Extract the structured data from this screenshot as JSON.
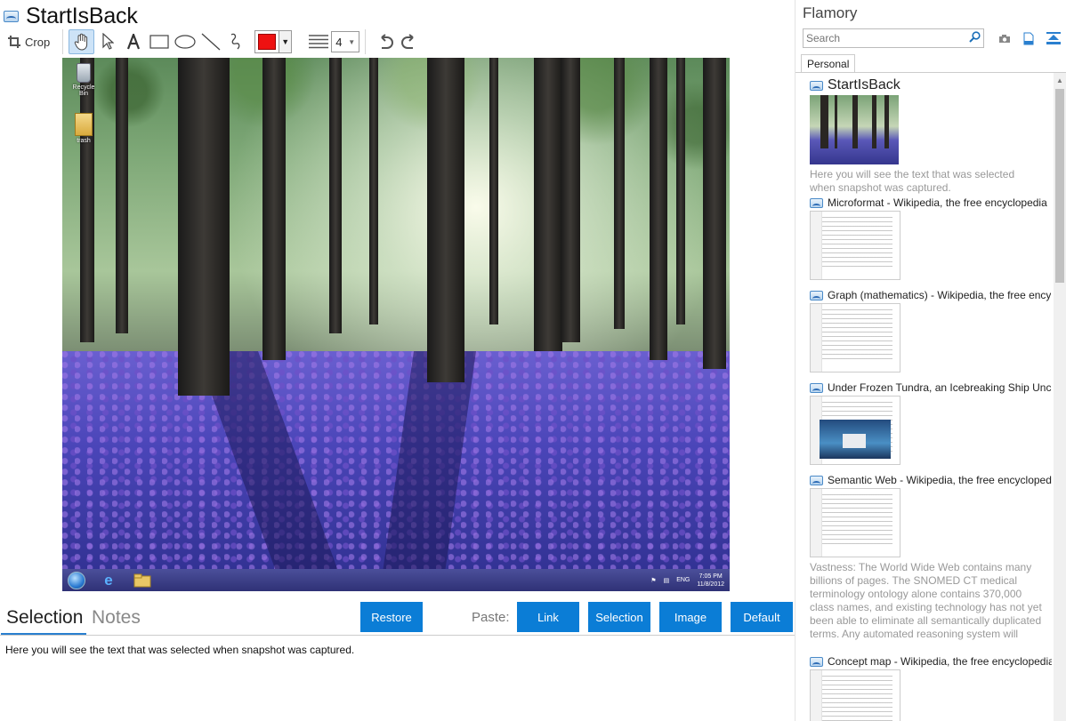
{
  "editor": {
    "title": "StartIsBack",
    "toolbar": {
      "crop_label": "Crop",
      "line_width": "4",
      "active_color": "#ee1111"
    },
    "desktop": {
      "icons": [
        "Recycle Bin",
        "trash"
      ],
      "tray_lang": "ENG",
      "clock_time": "7:05 PM",
      "clock_date": "11/8/2012"
    }
  },
  "tabs": {
    "selection": "Selection",
    "notes": "Notes"
  },
  "buttons": {
    "restore": "Restore",
    "paste_label": "Paste:",
    "link": "Link",
    "selection": "Selection",
    "image": "Image",
    "default": "Default"
  },
  "selection_text": "Here you will see the text that was selected when snapshot was captured.",
  "flamory": {
    "title": "Flamory",
    "search_placeholder": "Search",
    "tab_personal": "Personal",
    "items": [
      {
        "title": "StartIsBack",
        "desc": "Here you will see the text that was selected when snapshot was captured."
      },
      {
        "title": "Microformat - Wikipedia, the free encyclopedia"
      },
      {
        "title": "Graph (mathematics) - Wikipedia, the free ency"
      },
      {
        "title": "Under Frozen Tundra, an Icebreaking Ship Unco"
      },
      {
        "title": "Semantic Web - Wikipedia, the free encycloped",
        "desc": "Vastness: The World Wide Web contains many billions of pages. The SNOMED CT medical terminology ontology alone contains 370,000 class names, and existing technology has not yet been able to eliminate all semantically duplicated terms. Any automated reasoning system will have to deal with truly huge inputs."
      },
      {
        "title": "Concept map - Wikipedia, the free encyclopedia"
      }
    ]
  },
  "colors": {
    "accent": "#0b7dd6"
  }
}
